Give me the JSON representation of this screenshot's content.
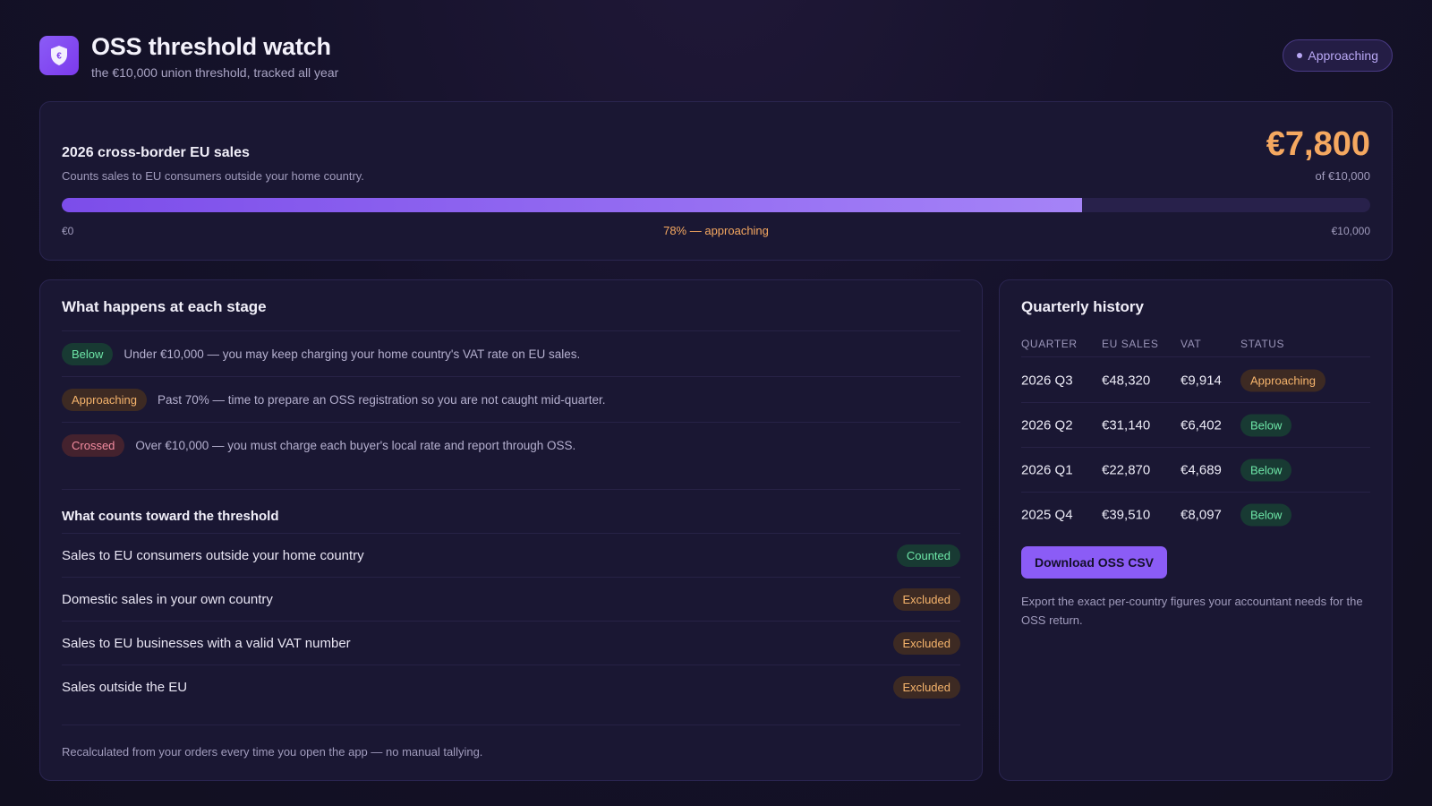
{
  "header": {
    "logo_icon": "shield-euro-icon",
    "title": "OSS threshold watch",
    "subtitle": "the €10,000 union threshold, tracked all year",
    "status": "Approaching"
  },
  "summary": {
    "title": "2026 cross-border EU sales",
    "description": "Counts sales to EU consumers outside your home country.",
    "amount": "€7,800",
    "amount_of": "of €10,000",
    "progress_fraction": 0.78,
    "min_label": "€0",
    "progress_label": "78% — approaching",
    "max_label": "€10,000",
    "colors": {
      "accent": "#8b5cf6",
      "amount": "#f5a860"
    }
  },
  "stages": {
    "title": "What happens at each stage",
    "items": [
      {
        "badge": "Below",
        "text": "Under €10,000 — you may keep charging your home country's VAT rate on EU sales."
      },
      {
        "badge": "Approaching",
        "text": "Past 70% — time to prepare an OSS registration so you are not caught mid-quarter."
      },
      {
        "badge": "Crossed",
        "text": "Over €10,000 — you must charge each buyer's local rate and report through OSS."
      }
    ]
  },
  "threshold": {
    "title": "What counts toward the threshold",
    "items": [
      {
        "label": "Sales to EU consumers outside your home country",
        "status": "Counted"
      },
      {
        "label": "Domestic sales in your own country",
        "status": "Excluded"
      },
      {
        "label": "Sales to EU businesses with a valid VAT number",
        "status": "Excluded"
      },
      {
        "label": "Sales outside the EU",
        "status": "Excluded"
      }
    ],
    "footnote": "Recalculated from your orders every time you open the app — no manual tallying."
  },
  "history": {
    "title": "Quarterly history",
    "columns": [
      "QUARTER",
      "EU SALES",
      "VAT",
      "STATUS"
    ],
    "rows": [
      {
        "quarter": "2026 Q3",
        "eu_sales": "€48,320",
        "vat": "€9,914",
        "status": "Approaching"
      },
      {
        "quarter": "2026 Q2",
        "eu_sales": "€31,140",
        "vat": "€6,402",
        "status": "Below"
      },
      {
        "quarter": "2026 Q1",
        "eu_sales": "€22,870",
        "vat": "€4,689",
        "status": "Below"
      },
      {
        "quarter": "2025 Q4",
        "eu_sales": "€39,510",
        "vat": "€8,097",
        "status": "Below"
      }
    ],
    "download_label": "Download OSS CSV",
    "download_note": "Export the exact per-country figures your accountant needs for the OSS return."
  }
}
